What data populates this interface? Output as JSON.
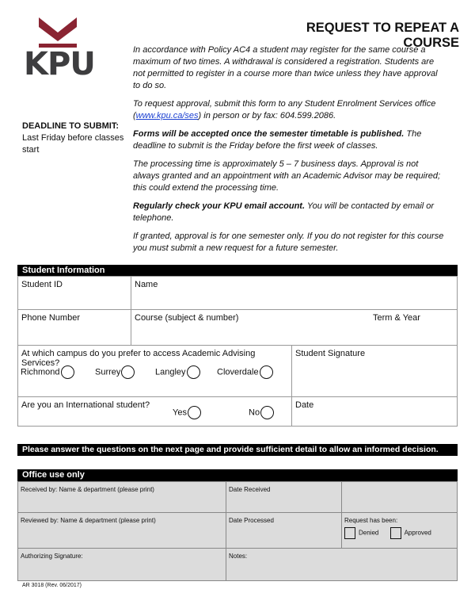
{
  "header": {
    "logo_text": "KPU",
    "title": "REQUEST TO REPEAT A COURSE"
  },
  "deadline": {
    "label": "DEADLINE TO SUBMIT:",
    "value": "Last Friday before classes start"
  },
  "intro": {
    "p1": "In accordance with Policy AC4 a student may register for the same course a maximum of two times. A withdrawal is considered a registration. Students are not permitted to register in a course more than twice unless they have approval to do so.",
    "p2_before": "To request approval, submit this form to any Student Enrolment Services office (",
    "p2_link": "www.kpu.ca/ses",
    "p2_after": ") in person or by fax: 604.599.2086.",
    "p3_bold": "Forms will be accepted once the semester timetable is published.",
    "p3_rest": "  The deadline to submit is the Friday before the first week of classes.",
    "p4": "The processing time is approximately 5 – 7 business days. Approval is not always granted and an appointment with an Academic Advisor may be required; this could extend the processing time.",
    "p5_bold": "Regularly check your KPU email account.",
    "p5_rest": " You will be contacted by email or telephone.",
    "p6": "If granted, approval is for one semester only. If you do not register for this course you must submit a new request for a future semester."
  },
  "student": {
    "header": "Student Information",
    "student_id": "Student ID",
    "name": "Name",
    "phone": "Phone Number",
    "course": "Course (subject & number)",
    "term": "Term & Year",
    "campus_q": "At which campus do you prefer to access Academic Advising Services?",
    "campuses": [
      "Richmond",
      "Surrey",
      "Langley",
      "Cloverdale"
    ],
    "signature": "Student Signature",
    "intl_q": "Are you an International student?",
    "yes": "Yes",
    "no": "No",
    "date": "Date"
  },
  "banner": "Please answer the questions on the next page and provide sufficient detail to allow an informed decision.",
  "office": {
    "header": "Office use only",
    "received_by": "Received by: Name & department (please print)",
    "date_received": "Date Received",
    "reviewed_by": "Reviewed by: Name & department (please print)",
    "date_processed": "Date Processed",
    "request_label": "Request has been:",
    "denied": "Denied",
    "approved": "Approved",
    "auth_sig": "Authorizing Signature:",
    "notes": "Notes:"
  },
  "footer": "AR 3018 (Rev. 06/2017)",
  "colors": {
    "brand": "#8a2432",
    "logo_gray": "#3d3d3f",
    "form_gray": "#dcdcdc"
  }
}
